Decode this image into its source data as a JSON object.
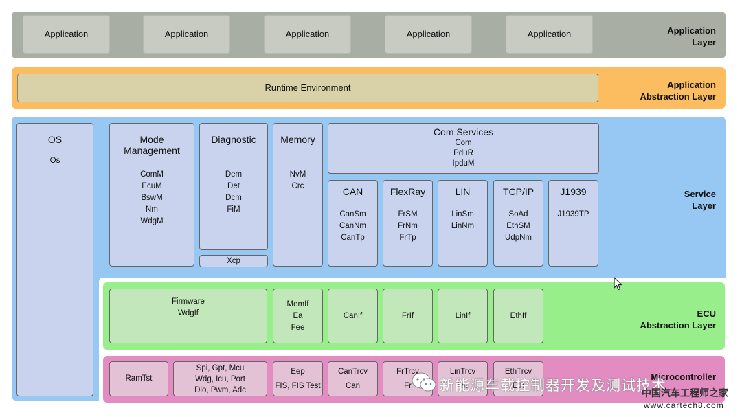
{
  "application_layer": {
    "label_line1": "Application",
    "label_line2": "Layer",
    "apps": [
      "Application",
      "Application",
      "Application",
      "Application",
      "Application"
    ]
  },
  "abstraction_layer": {
    "label_line1": "Application",
    "label_line2": "Abstraction Layer",
    "rte": "Runtime Environment"
  },
  "service_layer": {
    "label_line1": "Service",
    "label_line2": "Layer",
    "os": {
      "title": "OS",
      "items": [
        "Os"
      ]
    },
    "mode": {
      "title_line1": "Mode",
      "title_line2": "Management",
      "items": [
        "ComM",
        "EcuM",
        "BswM",
        "Nm",
        "WdgM"
      ]
    },
    "diagnostic": {
      "title": "Diagnostic",
      "items": [
        "Dem",
        "Det",
        "Dcm",
        "FiM"
      ],
      "xcp": "Xcp"
    },
    "memory": {
      "title": "Memory",
      "items": [
        "NvM",
        "Crc"
      ]
    },
    "com_services": {
      "title": "Com Services",
      "items": [
        "Com",
        "PduR",
        "IpduM"
      ]
    },
    "can": {
      "title": "CAN",
      "items": [
        "CanSm",
        "CanNm",
        "CanTp"
      ]
    },
    "flexray": {
      "title": "FlexRay",
      "items": [
        "FrSM",
        "FrNm",
        "FrTp"
      ]
    },
    "lin": {
      "title": "LIN",
      "items": [
        "LinSm",
        "LinNm"
      ]
    },
    "tcpip": {
      "title": "TCP/IP",
      "items": [
        "SoAd",
        "EthSM",
        "UdpNm"
      ]
    },
    "j1939": {
      "title": "J1939",
      "items": [
        "J1939TP"
      ]
    }
  },
  "ecu_layer": {
    "label_line1": "ECU",
    "label_line2": "Abstraction Layer",
    "firmware": [
      "Firmware",
      "WdgIf"
    ],
    "memif": [
      "MemIf",
      "Ea",
      "Fee"
    ],
    "canif": "CanIf",
    "frif": "FrIf",
    "linif": "LinIf",
    "ethif": "EthIf"
  },
  "mcu_layer": {
    "label": "Microcontroller",
    "ramtst": "RamTst",
    "spi": [
      "Spi, Gpt, Mcu",
      "Wdg, Icu, Port",
      "Dio, Pwm, Adc"
    ],
    "eep": [
      "Eep",
      "FIS, FIS Test"
    ],
    "can": [
      "CanTrcv",
      "Can"
    ],
    "fr": [
      "FrTrcv",
      "Fr"
    ],
    "lin": [
      "LinTrcv",
      "Lin"
    ],
    "eth": [
      "EthTrcv",
      "Eth"
    ]
  },
  "watermark": {
    "text": "新能源车载控制器开发及测试技术",
    "site_name": "中国汽车工程师之家",
    "url": "www.cartech8.com"
  },
  "colors": {
    "application": "#a9aea5",
    "abstraction": "#fbbd60",
    "service": "#97c8f3",
    "ecu": "#97ee8a",
    "mcu": "#e28cc2"
  }
}
